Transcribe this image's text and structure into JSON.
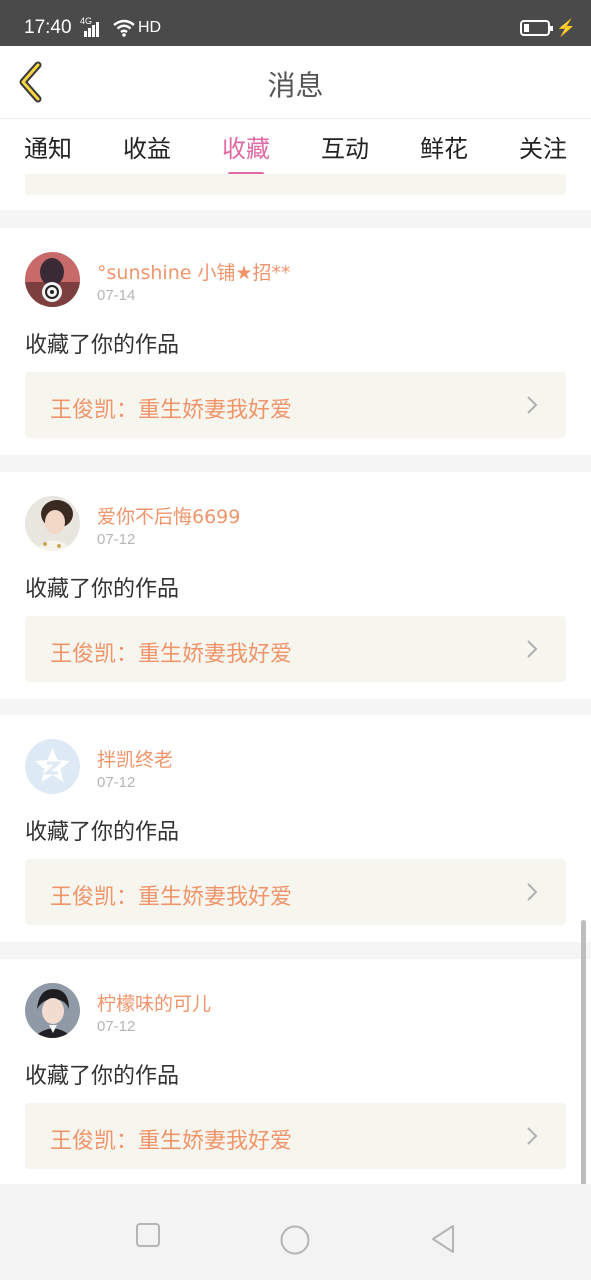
{
  "status_bar": {
    "time": "17:40",
    "network": "4G",
    "hd": "HD",
    "charge_glyph": "⚡"
  },
  "header": {
    "title": "消息",
    "back_icon": "chevron-left-icon"
  },
  "tabs": [
    {
      "label": "通知",
      "active": false
    },
    {
      "label": "收益",
      "active": false
    },
    {
      "label": "收藏",
      "active": true
    },
    {
      "label": "互动",
      "active": false
    },
    {
      "label": "鲜花",
      "active": false
    },
    {
      "label": "关注",
      "active": false
    }
  ],
  "colors": {
    "accent": "#e06aa3",
    "username": "#f0956b",
    "work_bg": "#f6f6ef"
  },
  "messages": [
    {
      "user": "°sunshine 小铺★招**",
      "date": "07-14",
      "action": "收藏了你的作品",
      "work": "王俊凯：重生娇妻我好爱"
    },
    {
      "user": "爱你不后悔6699",
      "date": "07-12",
      "action": "收藏了你的作品",
      "work": "王俊凯：重生娇妻我好爱"
    },
    {
      "user": "拌凯终老",
      "date": "07-12",
      "action": "收藏了你的作品",
      "work": "王俊凯：重生娇妻我好爱"
    },
    {
      "user": "柠檬味的可儿",
      "date": "07-12",
      "action": "收藏了你的作品",
      "work": "王俊凯：重生娇妻我好爱"
    }
  ],
  "navbar": {
    "icons": [
      "recent-apps-icon",
      "home-icon",
      "back-triangle-icon"
    ]
  }
}
